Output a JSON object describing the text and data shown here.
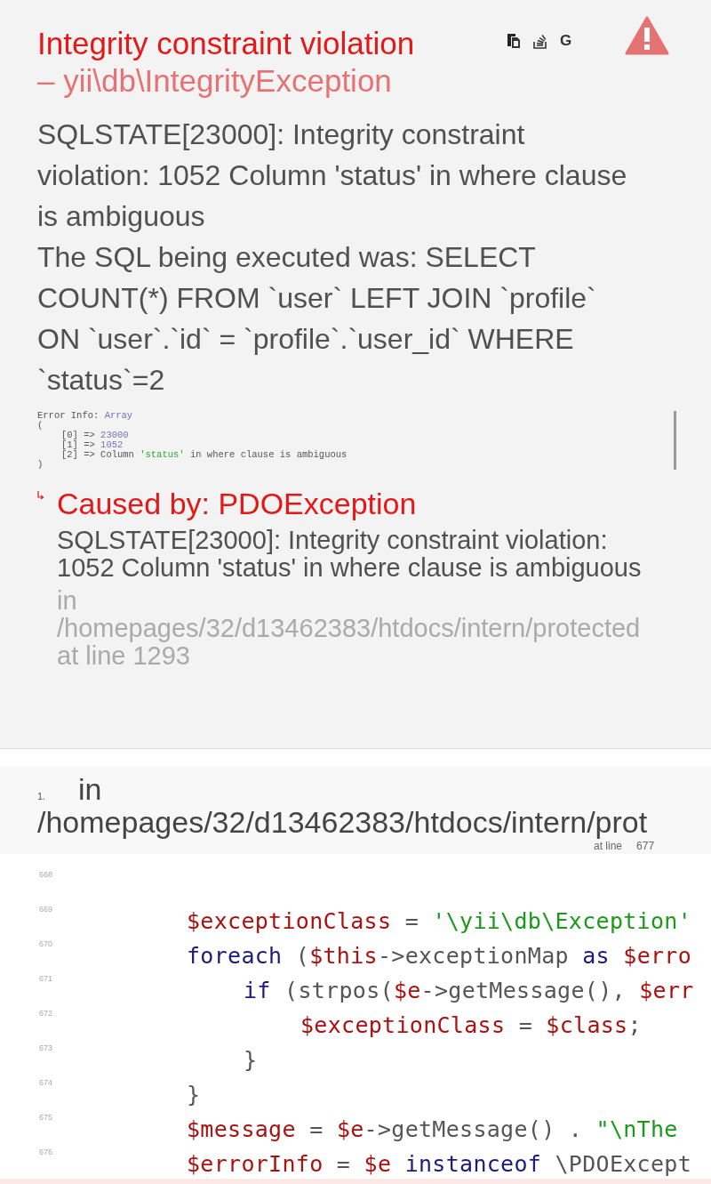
{
  "header": {
    "title": "Integrity constraint violation",
    "subtitle": "– yii\\db\\IntegrityException",
    "tools": [
      {
        "kind": "copy"
      },
      {
        "kind": "stackoverflow"
      },
      {
        "kind": "letter",
        "text": "G"
      }
    ],
    "message": "SQLSTATE[23000]: Integrity constraint violation: 1052 Column 'status' in where clause is ambiguous\nThe SQL being executed was: SELECT COUNT(*) FROM `user` LEFT JOIN `profile` ON `user`.`id` = `profile`.`user_id` WHERE `status`=2",
    "error_info": [
      [
        {
          "text": "Error Info: ",
          "kind": "plain"
        },
        {
          "text": "Array",
          "kind": "value"
        }
      ],
      [
        {
          "text": "(",
          "kind": "plain"
        }
      ],
      [
        {
          "text": "[0] => ",
          "kind": "key"
        },
        {
          "text": "23000",
          "kind": "value"
        }
      ],
      [
        {
          "text": "[1] => ",
          "kind": "key"
        },
        {
          "text": "1052",
          "kind": "value"
        }
      ],
      [
        {
          "text": "[2] => Column ",
          "kind": "key"
        },
        {
          "text": "'status'",
          "kind": "string"
        },
        {
          "text": " in where clause is ambiguous",
          "kind": "plain"
        }
      ],
      [
        {
          "text": ")",
          "kind": "plain"
        }
      ]
    ],
    "previous": {
      "title": "Caused by: PDOException",
      "message": "SQLSTATE[23000]: Integrity constraint violation: 1052 Column 'status' in where clause is ambiguous",
      "in": "in",
      "file": "/homepages/32/d13462383/htdocs/intern/protected",
      "line": "at line 1293"
    }
  },
  "call_stack": [
    {
      "number": "1.",
      "in": "in",
      "file": "/homepages/32/d13462383/htdocs/intern/prot",
      "at_line": "at line",
      "line": "677",
      "code": [
        {
          "number": "668"
        },
        {
          "number": "669",
          "tokens": [
            {
              "text": "$exceptionClass",
              "kind": "var"
            },
            {
              "text": " = ",
              "kind": "plain"
            },
            {
              "text": "'\\yii\\db\\Exception'",
              "kind": "string"
            }
          ]
        },
        {
          "number": "670",
          "tokens": [
            {
              "text": "foreach",
              "kind": "keyword"
            },
            {
              "text": " (",
              "kind": "plain"
            },
            {
              "text": "$this",
              "kind": "var"
            },
            {
              "text": "->exceptionMap ",
              "kind": "plain"
            },
            {
              "text": "as ",
              "kind": "keyword"
            },
            {
              "text": "$erro",
              "kind": "var"
            }
          ],
          "children": [
            {
              "number": "671",
              "tokens": [
                {
                  "text": "if",
                  "kind": "keyword"
                },
                {
                  "text": " (strpos(",
                  "kind": "plain"
                },
                {
                  "text": "$e",
                  "kind": "var"
                },
                {
                  "text": "->getMessage(), ",
                  "kind": "plain"
                },
                {
                  "text": "$err",
                  "kind": "var"
                }
              ],
              "children": [
                {
                  "number": "672",
                  "tokens": [
                    {
                      "text": "$exceptionClass",
                      "kind": "var"
                    },
                    {
                      "text": " = ",
                      "kind": "plain"
                    },
                    {
                      "text": "$class",
                      "kind": "var"
                    },
                    {
                      "text": ";",
                      "kind": "plain"
                    }
                  ]
                }
              ]
            },
            {
              "number": "673",
              "tokens": [
                {
                  "text": "}",
                  "kind": "plain"
                }
              ]
            }
          ]
        },
        {
          "number": "674",
          "tokens": [
            {
              "text": "}",
              "kind": "plain"
            }
          ]
        },
        {
          "number": "675",
          "tokens": [
            {
              "text": "$message",
              "kind": "var"
            },
            {
              "text": " = ",
              "kind": "plain"
            },
            {
              "text": "$e",
              "kind": "var"
            },
            {
              "text": "->getMessage() . ",
              "kind": "plain"
            },
            {
              "text": "\"\\nThe",
              "kind": "string"
            }
          ]
        },
        {
          "number": "676",
          "tokens": [
            {
              "text": "$errorInfo",
              "kind": "var"
            },
            {
              "text": " = ",
              "kind": "plain"
            },
            {
              "text": "$e ",
              "kind": "var"
            },
            {
              "text": "instanceof",
              "kind": "keyword"
            },
            {
              "text": " \\PDOExcept",
              "kind": "plain"
            }
          ]
        }
      ]
    }
  ]
}
